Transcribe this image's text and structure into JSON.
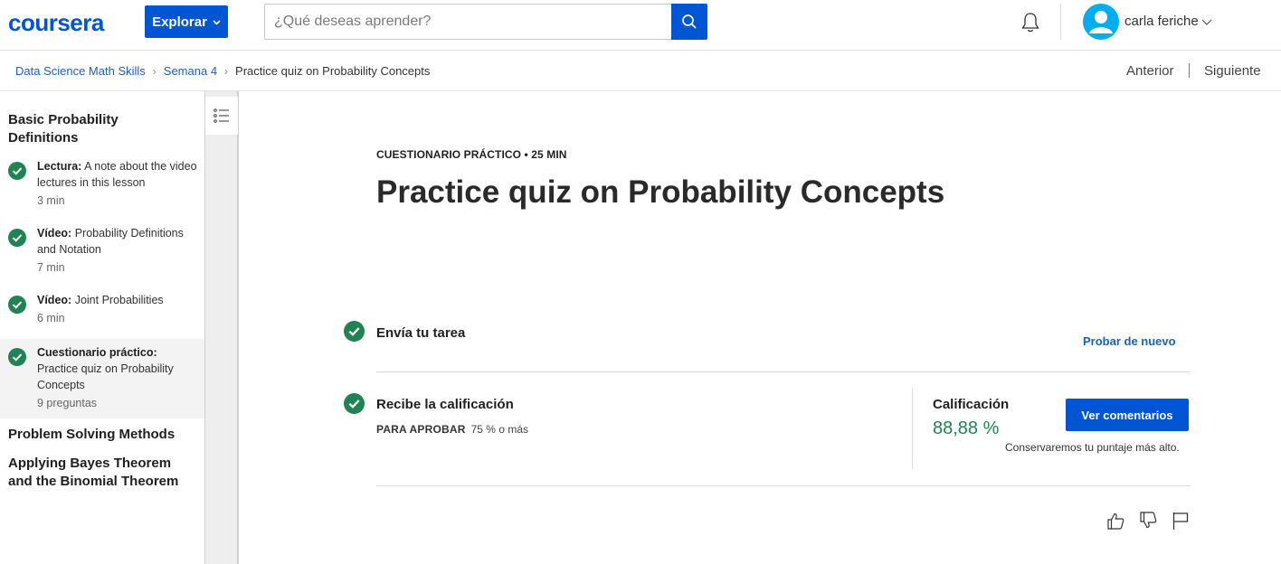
{
  "header": {
    "logo_text": "coursera",
    "explore_label": "Explorar",
    "search_placeholder": "¿Qué deseas aprender?",
    "user_name": "carla feriche",
    "brand_color": "#0056d2",
    "icons": [
      "search-icon",
      "bell-icon",
      "avatar-icon",
      "chevron-down-icon"
    ]
  },
  "breadcrumb": {
    "items": [
      "Data Science Math Skills",
      "Semana 4"
    ],
    "current": "Practice quiz on Probability Concepts",
    "prev_label": "Anterior",
    "next_label": "Siguiente"
  },
  "sidebar": {
    "section1_title": "Basic Probability Definitions",
    "items": [
      {
        "type": "Lectura:",
        "title": "A note about the video lectures in this lesson",
        "meta": "3 min"
      },
      {
        "type": "Vídeo:",
        "title": "Probability Definitions and Notation",
        "meta": "7 min"
      },
      {
        "type": "Vídeo:",
        "title": "Joint Probabilities",
        "meta": "6 min"
      },
      {
        "type": "Cuestionario práctico:",
        "title": "Practice quiz on Probability Concepts",
        "meta": "9 preguntas"
      }
    ],
    "section2_title": "Problem Solving Methods",
    "section3_title": "Applying Bayes Theorem and the Binomial Theorem"
  },
  "main": {
    "kicker": "CUESTIONARIO PRÁCTICO • 25 MIN",
    "title": "Practice quiz on Probability Concepts",
    "step1_label": "Envía tu tarea",
    "retry_label": "Probar de nuevo",
    "step2_label": "Recibe la calificación",
    "pass_key": "PARA APROBAR",
    "pass_value": "75 % o más",
    "grade_label": "Calificación",
    "grade_value": "88,88 %",
    "grade_color": "#1f8354",
    "feedback_button": "Ver comentarios",
    "keep_note": "Conservaremos tu puntaje más alto."
  }
}
